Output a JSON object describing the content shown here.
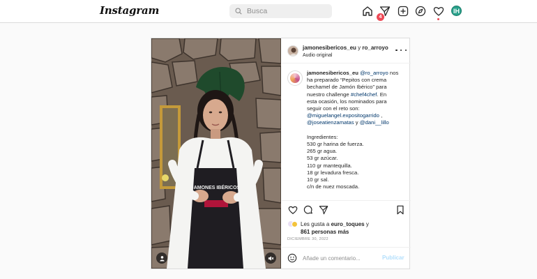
{
  "header": {
    "logo": "Instagram",
    "search_placeholder": "Busca",
    "notification_count": "4",
    "profile_initials": "IH"
  },
  "post": {
    "author": "jamonesibericos_eu",
    "coauthor_joiner": " y ",
    "coauthor": "ro_arroyo",
    "audio": "Audio original",
    "caption": {
      "author": "jamonesibericos_eu",
      "mention_1": "@ro_arroyo",
      "line1_tail": " nos",
      "line2": "ha preparado “Pepitos con crema",
      "line3": "bechamel de Jamón Ibérico” para",
      "line4_pre": "nuestro challenge ",
      "hashtag": "#chef4chef",
      "line4_tail": ". En",
      "line5": "esta ocasión, los nominados para",
      "line6": "seguir con el reto son:",
      "mention_2": "@miguelangel.expositogarrido",
      "line7_tail": " ,",
      "mention_3": "@joseatienzamatas",
      "line8_mid": " y ",
      "mention_4": "@dani__lillo",
      "ingredients_title": "Ingredientes:",
      "ingredients": [
        "530 gr harina de fuerza.",
        "265 gr agua.",
        "53 gr azúcar.",
        "110 gr mantequilla.",
        "18 gr levadura fresca.",
        "10 gr sal.",
        "c/n de nuez moscada."
      ]
    },
    "likes_prefix": "Les gusta a ",
    "likes_user": "euro_toques",
    "likes_suffix": " y",
    "likes_others": "861 personas más",
    "date": "DICIEMBRE 30, 2022",
    "comment_placeholder": "Añade un comentario...",
    "publish_label": "Publicar",
    "apron_text": "JAMONES IBÉRICOS"
  },
  "colors": {
    "link": "#00376b",
    "badge": "#ed4956",
    "publish_disabled": "#b2dffc"
  }
}
